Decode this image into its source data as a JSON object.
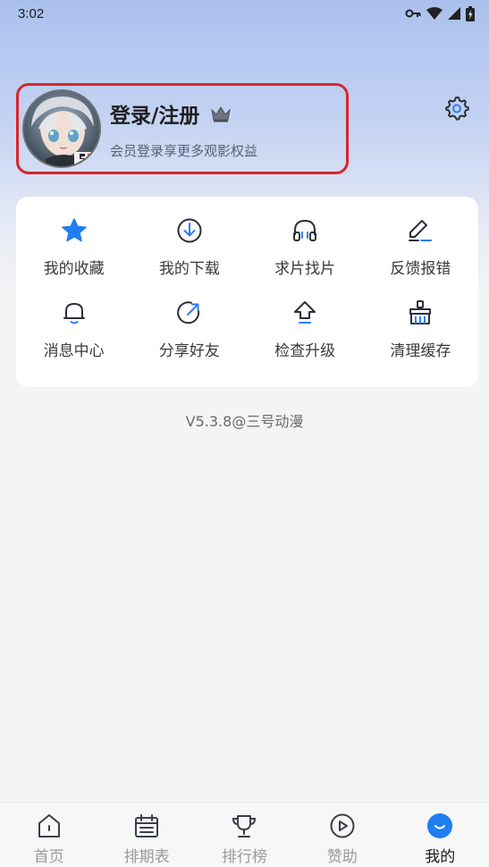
{
  "status_bar": {
    "time": "3:02",
    "icons": [
      "vpn-key-icon",
      "wifi-icon",
      "signal-icon",
      "battery-icon"
    ]
  },
  "profile": {
    "title": "登录/注册",
    "subtitle": "会员登录享更多观影权益",
    "crown_icon": "crown-icon",
    "avatar": "anime-avatar"
  },
  "settings_icon": "gear-icon",
  "grid": {
    "items": [
      {
        "label": "我的收藏",
        "icon": "star-icon"
      },
      {
        "label": "我的下载",
        "icon": "download-icon"
      },
      {
        "label": "求片找片",
        "icon": "headphones-icon"
      },
      {
        "label": "反馈报错",
        "icon": "edit-icon"
      },
      {
        "label": "消息中心",
        "icon": "bell-icon"
      },
      {
        "label": "分享好友",
        "icon": "share-icon"
      },
      {
        "label": "检查升级",
        "icon": "upgrade-icon"
      },
      {
        "label": "清理缓存",
        "icon": "broom-icon"
      }
    ]
  },
  "version": "V5.3.8@三号动漫",
  "bottom_nav": {
    "items": [
      {
        "label": "首页",
        "icon": "home-icon"
      },
      {
        "label": "排期表",
        "icon": "calendar-icon"
      },
      {
        "label": "排行榜",
        "icon": "trophy-icon"
      },
      {
        "label": "赞助",
        "icon": "play-circle-icon"
      },
      {
        "label": "我的",
        "icon": "profile-icon",
        "active": true
      }
    ]
  },
  "colors": {
    "accent": "#2f7cf6",
    "highlight_border": "#d9262c",
    "card": "#ffffff",
    "background": "#f4f4f5"
  }
}
